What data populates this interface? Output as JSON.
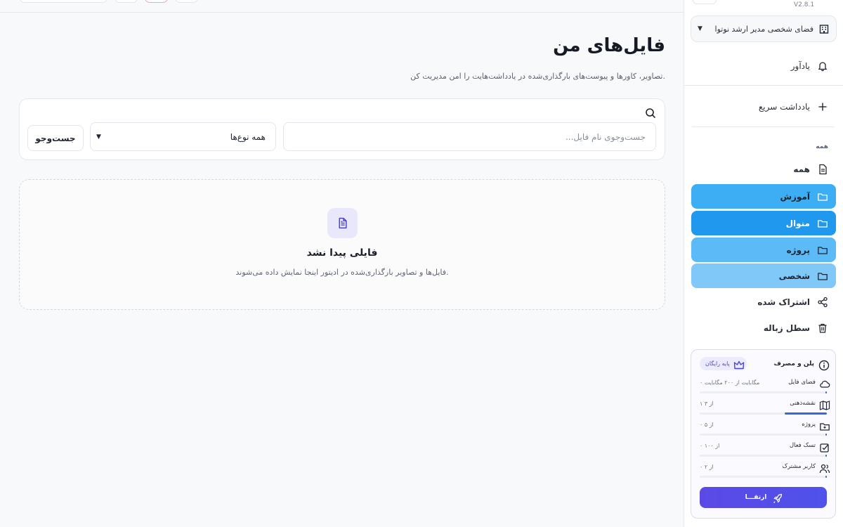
{
  "app": {
    "version": "V2.8.1"
  },
  "colors": {
    "accent": "#5b49e6",
    "folder_blue": "#3eaef4",
    "folder_selected": "#1f98ee",
    "folder_light": "#80c8f8"
  },
  "sidebar": {
    "workspace": {
      "label": "فضای شخصی مدیر ارشد نوتوا",
      "icon": "building-icon"
    },
    "reminder": {
      "label": "یادآور",
      "icon": "bell-icon"
    },
    "quick_note": {
      "label": "یادداشت سریع",
      "icon": "plus-icon"
    },
    "section_title": "همه",
    "all": {
      "label": "همه",
      "icon": "document-icon"
    },
    "folders": [
      {
        "label": "آموزش",
        "icon": "folder-icon",
        "color": "#3eaef4",
        "selected": false
      },
      {
        "label": "منوال",
        "icon": "folder-icon",
        "color": "#1f98ee",
        "selected": true
      },
      {
        "label": "پروژه",
        "icon": "folder-icon",
        "color": "#5cbaf6",
        "selected": false
      },
      {
        "label": "شخصی",
        "icon": "folder-icon",
        "color": "#80c8f8",
        "selected": false
      }
    ],
    "shared": {
      "label": "اشتراک شده",
      "icon": "share-icon"
    },
    "trash": {
      "label": "سطل زباله",
      "icon": "trash-icon"
    },
    "plan": {
      "title": "پلن و مصرف",
      "badge": "پایه رایگان",
      "items": [
        {
          "label": "فضای فایل",
          "value": "۰ مگابایت از ۲۰۰ مگابایت",
          "fraction": 0,
          "icon": "cloud-icon"
        },
        {
          "label": "نقشه‌ذهنی",
          "value": "۱ از ۳",
          "fraction": 0.33,
          "icon": "map-icon"
        },
        {
          "label": "پروژه",
          "value": "۰ از ۵",
          "fraction": 0,
          "icon": "folder-icon"
        },
        {
          "label": "تسک فعال",
          "value": "۰ از ۱۰۰",
          "fraction": 0,
          "icon": "checkbox-icon"
        },
        {
          "label": "کاربر مشترک",
          "value": "۰ از ۲",
          "fraction": 0,
          "icon": "users-icon"
        }
      ],
      "upgrade_label": "ارتقـــا"
    }
  },
  "main": {
    "title": "فایل‌های من",
    "subtitle": "تصاویر، کاورها و پیوست‌های بارگذاری‌شده در یادداشت‌هایت را امن مدیریت کن.",
    "search": {
      "placeholder": "جست‌وجوی نام فایل...",
      "value": ""
    },
    "type_filter": {
      "value": "همه نوع‌ها"
    },
    "search_button": "جست‌وجو",
    "empty": {
      "title": "فایلی پیدا نشد",
      "subtitle": "فایل‌ها و تصاویر بارگذاری‌شده در ادیتور اینجا نمایش داده می‌شوند."
    }
  }
}
